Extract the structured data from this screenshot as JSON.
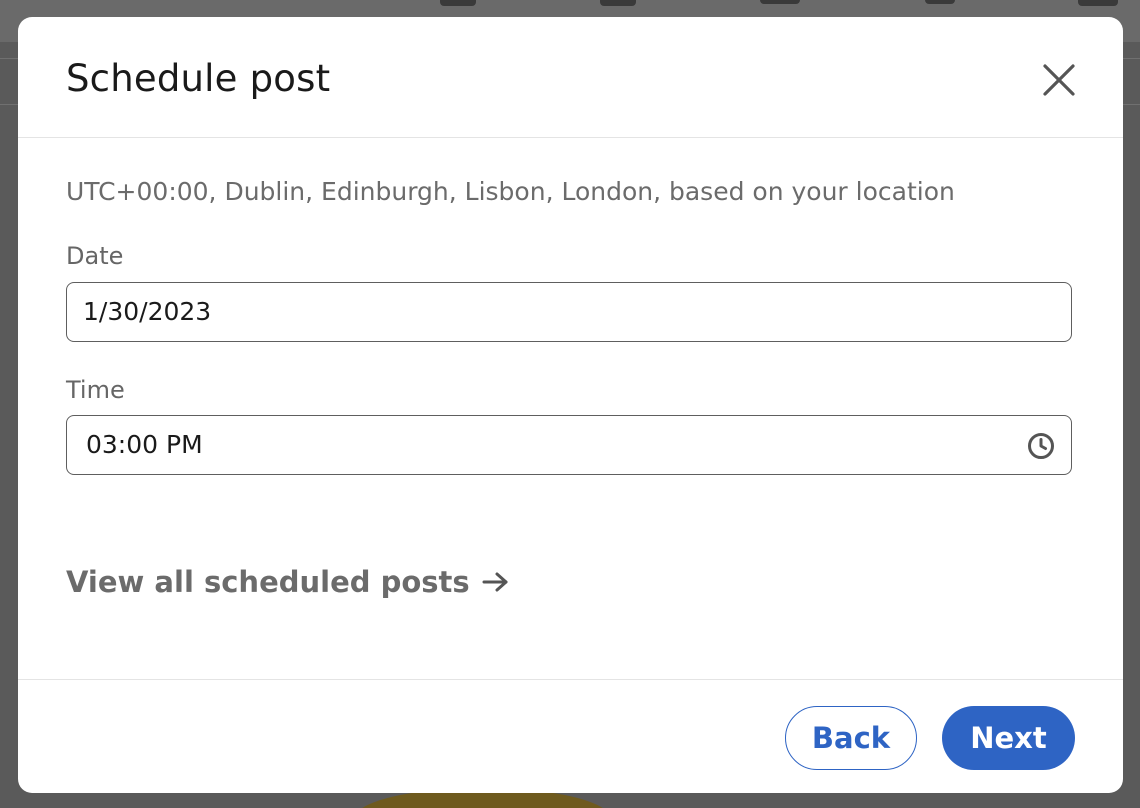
{
  "modal": {
    "title": "Schedule post",
    "timezone_note": "UTC+00:00, Dublin, Edinburgh, Lisbon, London, based on your location",
    "date": {
      "label": "Date",
      "value": "1/30/2023"
    },
    "time": {
      "label": "Time",
      "value": "03:00 PM"
    },
    "view_all_link": "View all scheduled posts",
    "buttons": {
      "back": "Back",
      "next": "Next"
    }
  },
  "icons": {
    "close": "close-icon",
    "clock": "clock-icon",
    "arrow": "arrow-right-icon"
  },
  "colors": {
    "primary": "#2e64c4",
    "muted_text": "#6b6b6b",
    "overlay": "#5a5a5a"
  }
}
